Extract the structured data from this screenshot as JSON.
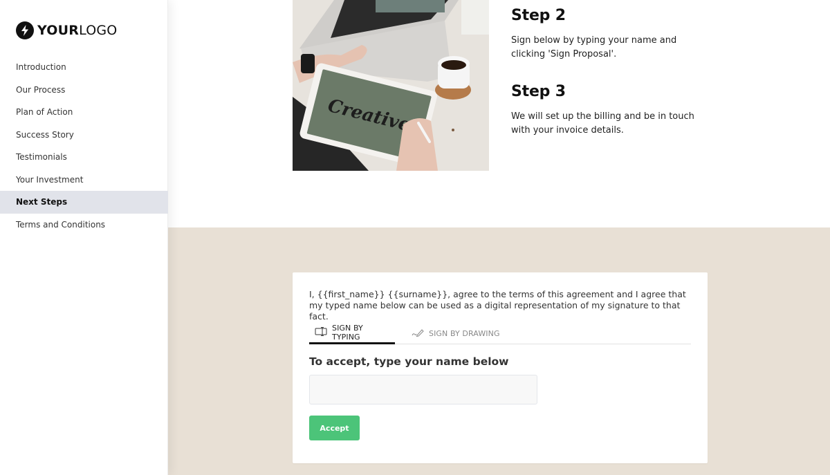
{
  "brand": {
    "logo_bold": "YOUR",
    "logo_light": "LOGO",
    "icon": "lightning-bolt-icon"
  },
  "sidebar": {
    "items": [
      {
        "label": "Introduction",
        "active": false
      },
      {
        "label": "Our Process",
        "active": false
      },
      {
        "label": "Plan of Action",
        "active": false
      },
      {
        "label": "Success Story",
        "active": false
      },
      {
        "label": "Testimonials",
        "active": false
      },
      {
        "label": "Your Investment",
        "active": false
      },
      {
        "label": "Next Steps",
        "active": true
      },
      {
        "label": "Terms and Conditions",
        "active": false
      }
    ]
  },
  "steps": [
    {
      "title": "Step 2",
      "text": "Sign below by typing your name and clicking 'Sign Proposal'."
    },
    {
      "title": "Step 3",
      "text": "We will set up the billing and be in touch with your invoice details."
    }
  ],
  "photo": {
    "alt": "Person using laptop and tablet showing 'Creative' lettering with coffee cup",
    "tablet_text": "Creative"
  },
  "signature": {
    "agreement_text": "I, {{first_name}} {{surname}}, agree to the terms of this agreement and I agree that my typed name below can be used as a digital representation of my signature to that fact.",
    "tabs": [
      {
        "label": "SIGN BY TYPING",
        "icon": "text-cursor-icon",
        "active": true
      },
      {
        "label": "SIGN BY DRAWING",
        "icon": "signature-pen-icon",
        "active": false
      }
    ],
    "input_label": "To accept, type your name below",
    "input_value": "",
    "input_placeholder": "",
    "accept_label": "Accept"
  },
  "colors": {
    "accent_green": "#4cc479",
    "beige_background": "#e8e0d5",
    "active_nav": "#e1e3ea"
  }
}
